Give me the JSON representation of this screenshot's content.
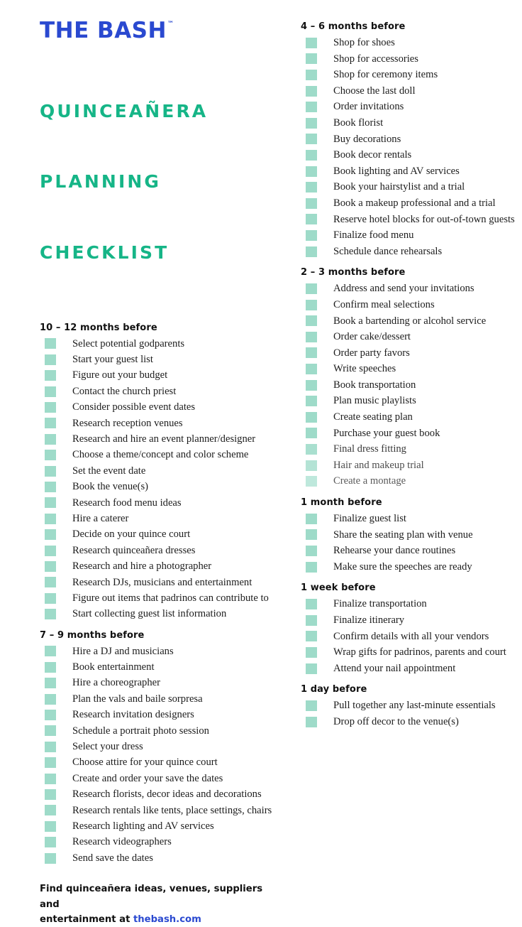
{
  "brand": {
    "name": "THE BASH",
    "trademark": "™",
    "logo_color": "#2a49d0"
  },
  "title": {
    "line1": "QUINCEAÑERA",
    "line2": "PLANNING",
    "line3": "CHECKLIST",
    "color": "#16b587"
  },
  "checkbox_color": "#9edbc9",
  "footer": {
    "line1": "Find quinceañera ideas, venues, suppliers and",
    "line2_prefix": "entertainment at ",
    "link": "thebash.com",
    "link_color": "#2a49d0"
  },
  "left_column": [
    {
      "heading": "10 – 12 months before",
      "items": [
        "Select potential godparents",
        "Start your guest list",
        "Figure out your budget",
        "Contact the church priest",
        "Consider possible event dates",
        "Research reception venues",
        "Research and hire an event planner/designer",
        "Choose a theme/concept and color scheme",
        "Set the event date",
        "Book the venue(s)",
        "Research food menu ideas",
        "Hire a caterer",
        "Decide on your quince court",
        "Research quinceañera dresses",
        "Research and hire a photographer",
        "Research DJs, musicians and entertainment",
        "Figure out items that padrinos can contribute to",
        "Start collecting guest list information"
      ]
    },
    {
      "heading": "7 – 9 months before",
      "items": [
        "Hire a DJ and musicians",
        "Book entertainment",
        "Hire a choreographer",
        "Plan the vals and baile sorpresa",
        "Research invitation designers",
        "Schedule a portrait photo session",
        "Select your dress",
        "Choose attire for your quince court",
        "Create and order your save the dates",
        "Research florists, decor ideas and decorations",
        "Research rentals like tents, place settings, chairs",
        "Research lighting and AV services",
        "Research videographers",
        "Send save the dates"
      ]
    }
  ],
  "right_column": [
    {
      "heading": "4 – 6 months before",
      "items": [
        "Shop for shoes",
        "Shop for accessories",
        "Shop for ceremony items",
        "Choose the last doll",
        "Order invitations",
        "Book florist",
        "Buy decorations",
        "Book decor rentals",
        "Book lighting and AV services",
        "Book your hairstylist and a trial",
        "Book a makeup professional and a trial",
        "Reserve hotel blocks for out-of-town guests",
        "Finalize food menu",
        "Schedule dance rehearsals"
      ]
    },
    {
      "heading": "2 – 3 months before",
      "items": [
        "Address and send your invitations",
        "Confirm meal selections",
        "Book a bartending or alcohol service",
        "Order cake/dessert",
        "Order party favors",
        "Write speeches",
        "Book transportation",
        "Plan music playlists",
        "Create seating plan",
        "Purchase your guest book",
        "Final dress fitting",
        "Hair and makeup trial",
        "Create a montage"
      ]
    },
    {
      "heading": "1 month before",
      "items": [
        "Finalize guest list",
        "Share the seating plan with venue",
        "Rehearse your dance routines",
        "Make sure the speeches are ready"
      ]
    },
    {
      "heading": "1 week before",
      "items": [
        "Finalize transportation",
        "Finalize itinerary",
        "Confirm details with all your vendors",
        "Wrap gifts for padrinos, parents and court",
        "Attend your nail appointment"
      ]
    },
    {
      "heading": "1 day before",
      "items": [
        "Pull together any last-minute essentials",
        "Drop off decor to the venue(s)"
      ]
    }
  ]
}
